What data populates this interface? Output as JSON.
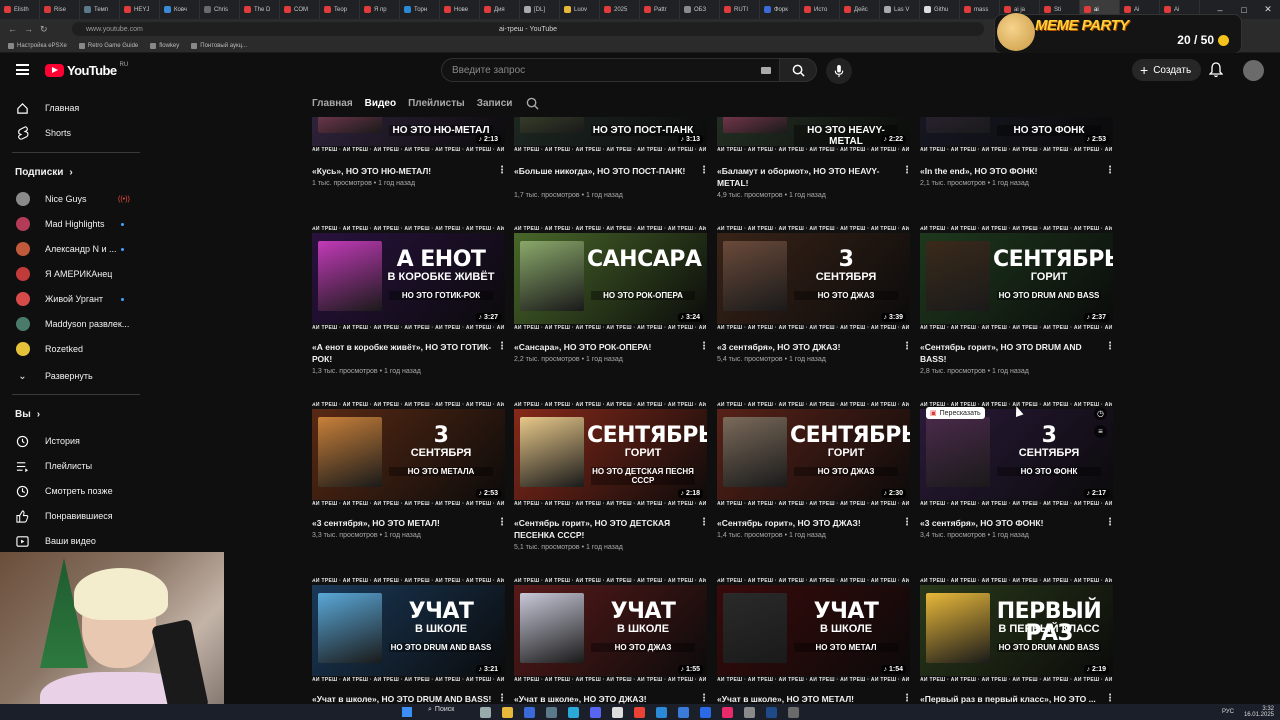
{
  "browser": {
    "tabs": [
      "Elisth",
      "Rise",
      "Темп",
      "HEYJ",
      "Ковч",
      "Chris",
      "The D",
      "COM",
      "Teop",
      "Я пр",
      "Торн",
      "Нове",
      "Дия",
      "[DL]",
      "Luov",
      "2025",
      "Pattr",
      "ОБЗ",
      "RUTI",
      "Форк",
      "Исто",
      "Дейс",
      "Las V",
      "Githu",
      "mass",
      "ai ja",
      "Sti",
      "ai",
      "Ai",
      "Ai"
    ],
    "url": "www.youtube.com",
    "page_title": "ai-треш - YouTube",
    "bookmarks": [
      "Настройка ePSXe",
      "Retro Game Guide",
      "flowkey",
      "Понтовый аукц..."
    ]
  },
  "meme_party": {
    "label": "MEME PARTY",
    "score": "20 / 50"
  },
  "header": {
    "logo_text": "YouTube",
    "logo_country": "RU",
    "search_placeholder": "Введите запрос",
    "create_label": "Создать"
  },
  "sidebar": {
    "main": [
      {
        "label": "Главная",
        "icon": "home-icon"
      },
      {
        "label": "Shorts",
        "icon": "shorts-icon"
      }
    ],
    "subs_heading": "Подписки",
    "subs": [
      {
        "label": "Nice Guys",
        "color": "#8a8a8a",
        "badge": "live"
      },
      {
        "label": "Mad Highlights",
        "color": "#b33b57",
        "badge": "dot"
      },
      {
        "label": "Александр N и ...",
        "color": "#c05a3a",
        "badge": "dot"
      },
      {
        "label": "Я АМЕРИКАнец",
        "color": "#c23b3b",
        "badge": ""
      },
      {
        "label": "Живой Ургант",
        "color": "#d64a4a",
        "badge": "dot"
      },
      {
        "label": "Maddyson развлек...",
        "color": "#4a7a6a",
        "badge": ""
      },
      {
        "label": "Rozetked",
        "color": "#e6c23a",
        "badge": ""
      }
    ],
    "expand_label": "Развернуть",
    "you_heading": "Вы",
    "you": [
      {
        "label": "История",
        "icon": "history-icon"
      },
      {
        "label": "Плейлисты",
        "icon": "playlists-icon"
      },
      {
        "label": "Смотреть позже",
        "icon": "watch-later-icon"
      },
      {
        "label": "Понравившиеся",
        "icon": "like-icon"
      },
      {
        "label": "Ваши видео",
        "icon": "your-videos-icon"
      }
    ]
  },
  "channel_tabs": [
    "Главная",
    "Видео",
    "Плейлисты",
    "Записи"
  ],
  "band_text": "АИ ТРЕШ · АИ ТРЕШ · АИ ТРЕШ · АИ ТРЕШ · АИ ТРЕШ · АИ ТРЕШ · АИ",
  "videos": [
    {
      "title": "«Кусь», НО ЭТО НЮ-МЕТАЛ!",
      "views": "1 тыс. просмотров",
      "age": "1 год назад",
      "duration": "2:13",
      "genre": "НО ЭТО НЮ-МЕТАЛ",
      "big": "",
      "sub": "",
      "bg": "#3a2a4a",
      "photo": "#d85a8a"
    },
    {
      "title": "«Больше никогда», НО ЭТО ПОСТ-ПАНК!",
      "views": "1,7 тыс. просмотров",
      "age": "1 год назад",
      "duration": "3:13",
      "genre": "НО ЭТО ПОСТ-ПАНК",
      "big": "",
      "sub": "",
      "bg": "#23302a",
      "photo": "#5a6a3a"
    },
    {
      "title": "«Баламут и обормот», НО ЭТО HEAVY-METAL!",
      "views": "4,9 тыс. просмотров",
      "age": "1 год назад",
      "duration": "2:22",
      "genre": "НО ЭТО HEAVY-METAL",
      "big": "",
      "sub": "",
      "bg": "#2a3a2a",
      "photo": "#e85a8a"
    },
    {
      "title": "«In the end», НО ЭТО ФОНК!",
      "views": "2,1 тыс. просмотров",
      "age": "1 год назад",
      "duration": "2:53",
      "genre": "НО ЭТО ФОНК",
      "big": "",
      "sub": "",
      "bg": "#1a1a2a",
      "photo": "#3a2a4a"
    },
    {
      "title": "«А енот в коробке живёт», НО ЭТО ГОТИК-РОК!",
      "views": "1,3 тыс. просмотров",
      "age": "1 год назад",
      "duration": "3:27",
      "genre": "НО ЭТО ГОТИК-РОК",
      "big": "А ЕНОТ",
      "sub": "В КОРОБКЕ ЖИВЁТ",
      "bg": "#2a1240",
      "photo": "#c23ab8"
    },
    {
      "title": "«Сансара», НО ЭТО РОК-ОПЕРА!",
      "views": "2,2 тыс. просмотров",
      "age": "1 год назад",
      "duration": "3:24",
      "genre": "НО ЭТО РОК-ОПЕРА",
      "big": "САНСАРА",
      "sub": "",
      "bg": "#4a6a2a",
      "photo": "#8aa86a"
    },
    {
      "title": "«3 сентября», НО ЭТО ДЖАЗ!",
      "views": "5,4 тыс. просмотров",
      "age": "1 год назад",
      "duration": "3:39",
      "genre": "НО ЭТО ДЖАЗ",
      "big": "3",
      "sub": "СЕНТЯБРЯ",
      "bg": "#3a2418",
      "photo": "#6a4a3a"
    },
    {
      "title": "«Сентябрь горит», НО ЭТО DRUM AND BASS!",
      "views": "2,8 тыс. просмотров",
      "age": "1 год назад",
      "duration": "2:37",
      "genre": "НО ЭТО DRUM AND BASS",
      "big": "СЕНТЯБРЬ",
      "sub": "ГОРИТ",
      "bg": "#1e3a1e",
      "photo": "#3a2a1a"
    },
    {
      "title": "«3 сентября», НО ЭТО МЕТАЛ!",
      "views": "3,3 тыс. просмотров",
      "age": "1 год назад",
      "duration": "2:53",
      "genre": "НО ЭТО МЕТАЛА",
      "big": "3",
      "sub": "СЕНТЯБРЯ",
      "bg": "#5a2a14",
      "photo": "#c8803a"
    },
    {
      "title": "«Сентябрь горит», НО ЭТО ДЕТСКАЯ ПЕСЕНКА СССР!",
      "views": "5,1 тыс. просмотров",
      "age": "1 год назад",
      "duration": "2:18",
      "genre": "НО ЭТО ДЕТСКАЯ ПЕСНЯ СССР",
      "big": "СЕНТЯБРЬ",
      "sub": "ГОРИТ",
      "bg": "#8a2a1a",
      "photo": "#e8c88a"
    },
    {
      "title": "«Сентябрь горит», НО ЭТО ДЖАЗ!",
      "views": "1,4 тыс. просмотров",
      "age": "1 год назад",
      "duration": "2:30",
      "genre": "НО ЭТО ДЖАЗ",
      "big": "СЕНТЯБРЬ",
      "sub": "ГОРИТ",
      "bg": "#5a2218",
      "photo": "#7a6a5a"
    },
    {
      "title": "«3 сентября», НО ЭТО ФОНК!",
      "views": "3,4 тыс. просмотров",
      "age": "1 год назад",
      "duration": "2:17",
      "genre": "НО ЭТО ФОНК",
      "big": "3",
      "sub": "СЕНТЯБРЯ",
      "bg": "#2a1a3a",
      "photo": "#4a2a4a",
      "hover": true
    },
    {
      "title": "«Учат в школе», НО ЭТО DRUM AND BASS!",
      "views": "",
      "age": "",
      "duration": "3:21",
      "genre": "НО ЭТО DRUM AND BASS",
      "big": "УЧАТ",
      "sub": "В ШКОЛЕ",
      "bg": "#1a3a5a",
      "photo": "#5aa8d8"
    },
    {
      "title": "«Учат в школе», НО ЭТО ДЖАЗ!",
      "views": "",
      "age": "",
      "duration": "1:55",
      "genre": "НО ЭТО ДЖАЗ",
      "big": "УЧАТ",
      "sub": "В ШКОЛЕ",
      "bg": "#5a1a1a",
      "photo": "#c8c8d8"
    },
    {
      "title": "«Учат в школе», НО ЭТО МЕТАЛ!",
      "views": "",
      "age": "",
      "duration": "1:54",
      "genre": "НО ЭТО МЕТАЛ",
      "big": "УЧАТ",
      "sub": "В ШКОЛЕ",
      "bg": "#3a0a0a",
      "photo": "#2a2a2a"
    },
    {
      "title": "«Первый раз в первый класс», НО ЭТО ...",
      "views": "",
      "age": "",
      "duration": "2:19",
      "genre": "НО ЭТО DRUM AND BASS",
      "big": "ПЕРВЫЙ РАЗ",
      "sub": "В ПЕРВЫЙ КЛАСС",
      "bg": "#2a3a1a",
      "photo": "#e8b83a"
    }
  ],
  "hover_chip": "Пересказать",
  "taskbar": {
    "search_label": "Поиск",
    "lang": "РУС",
    "time": "3:32",
    "date": "16.01.2025"
  }
}
